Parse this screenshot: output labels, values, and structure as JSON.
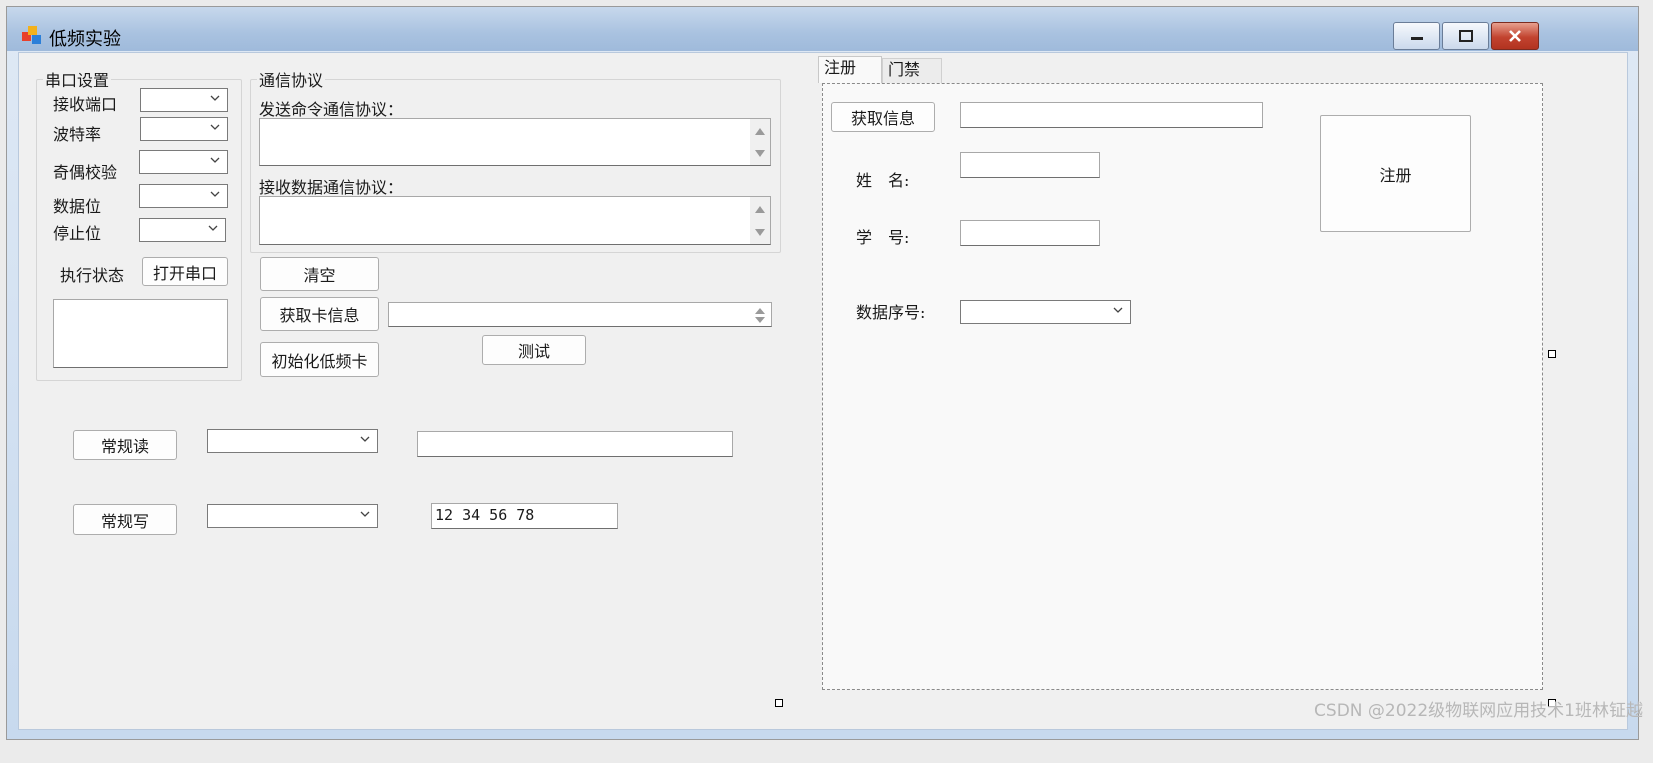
{
  "window": {
    "title": "低频实验",
    "icon": "app-icon",
    "controls": [
      "minimize-icon",
      "maximize-icon",
      "close-icon"
    ]
  },
  "serial_group": {
    "legend": "串口设置",
    "receive_port_label": "接收端口",
    "baud_rate_label": "波特率",
    "parity_label": "奇偶校验",
    "data_bits_label": "数据位",
    "stop_bits_label": "停止位",
    "status_label": "执行状态",
    "open_port_button": "打开串口"
  },
  "protocol_group": {
    "legend": "通信协议",
    "send_label": "发送命令通信协议：",
    "receive_label": "接收数据通信协议："
  },
  "actions": {
    "clear_button": "清空",
    "get_card_button": "获取卡信息",
    "init_card_button": "初始化低频卡",
    "test_button": "测试",
    "read_button": "常规读",
    "write_button": "常规写",
    "write_value": "12 34 56 78"
  },
  "tabs": [
    "注册",
    "门禁"
  ],
  "register_tab": {
    "get_info_button": "获取信息",
    "name_label": "姓　名:",
    "student_id_label": "学　号:",
    "data_index_label": "数据序号:",
    "register_button": "注册"
  },
  "watermark": "CSDN @2022级物联网应用技术1班林钲越"
}
